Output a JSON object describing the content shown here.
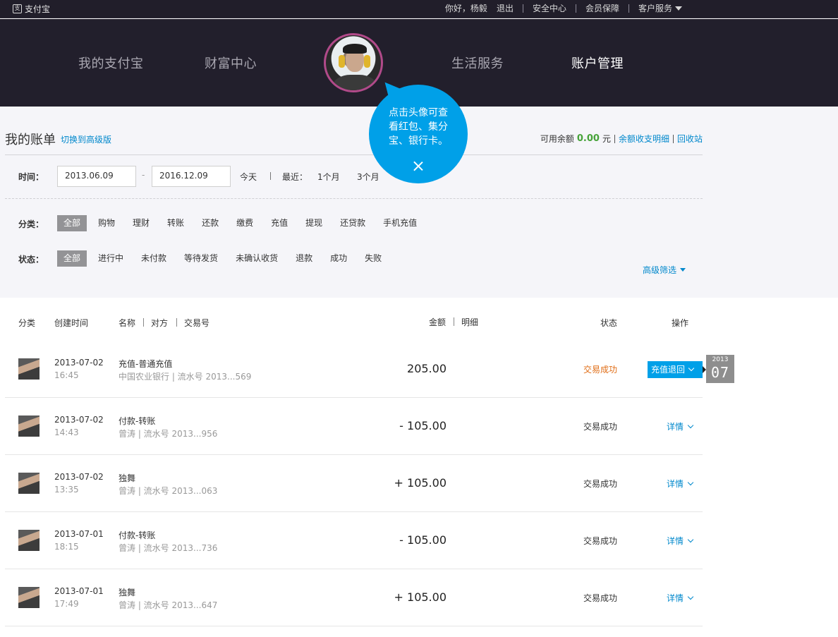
{
  "topbar": {
    "brand": "支付宝",
    "greeting": "你好，杨毅",
    "logout": "退出",
    "security": "安全中心",
    "member": "会员保障",
    "service": "客户服务"
  },
  "nav": {
    "items": [
      "我的支付宝",
      "财富中心",
      "生活服务",
      "账户管理"
    ],
    "active": "账户管理"
  },
  "tooltip": {
    "text": "点击头像可查看红包、集分宝、银行卡。"
  },
  "bill": {
    "title": "我的账单",
    "switch_link": "切换到高级版",
    "balance_label": "可用余额",
    "balance_amount": "0.00",
    "balance_unit": "元",
    "balance_detail_link": "余额收支明细",
    "recycle_link": "回收站"
  },
  "filters": {
    "time_label": "时间：",
    "start_date": "2013.06.09",
    "end_date": "2016.12.09",
    "date_dash": "-",
    "today": "今天",
    "recent_label": "最近：",
    "one_month": "1个月",
    "three_months": "3个月",
    "category_label": "分类：",
    "categories": [
      "全部",
      "购物",
      "理财",
      "转账",
      "还款",
      "缴费",
      "充值",
      "提现",
      "还贷款",
      "手机充值"
    ],
    "status_label": "状态：",
    "statuses": [
      "全部",
      "进行中",
      "未付款",
      "等待发货",
      "未确认收货",
      "退款",
      "成功",
      "失败"
    ],
    "advanced": "高级筛选"
  },
  "table": {
    "headers": {
      "category": "分类",
      "created": "创建时间",
      "name": "名称",
      "counterparty": "对方",
      "trade_no": "交易号",
      "amount": "金额",
      "detail": "明细",
      "status": "状态",
      "action": "操作"
    },
    "rows": [
      {
        "date": "2013-07-02",
        "time": "16:45",
        "name": "充值-普通充值",
        "sub": "中国农业银行 | 流水号 2013...569",
        "amount": "205.00",
        "status": "交易成功",
        "action": "充值退回"
      },
      {
        "date": "2013-07-02",
        "time": "14:43",
        "name": "付款-转账",
        "sub": "曾涛 | 流水号 2013...956",
        "amount": "- 105.00",
        "status": "交易成功",
        "action": "详情"
      },
      {
        "date": "2013-07-02",
        "time": "13:35",
        "name": "独舞",
        "sub": "曾涛 | 流水号 2013...063",
        "amount": "+ 105.00",
        "status": "交易成功",
        "action": "详情"
      },
      {
        "date": "2013-07-01",
        "time": "18:15",
        "name": "付款-转账",
        "sub": "曾涛 | 流水号 2013...736",
        "amount": "- 105.00",
        "status": "交易成功",
        "action": "详情"
      },
      {
        "date": "2013-07-01",
        "time": "17:49",
        "name": "独舞",
        "sub": "曾涛 | 流水号 2013...647",
        "amount": "+ 105.00",
        "status": "交易成功",
        "action": "详情"
      }
    ]
  },
  "date_badge": {
    "year": "2013",
    "month": "07"
  },
  "colors": {
    "accent": "#00a0e8",
    "link": "#0088cc",
    "nav_bg": "#221f2c",
    "success_orange": "#e06d16",
    "balance_green": "#47a33a"
  }
}
